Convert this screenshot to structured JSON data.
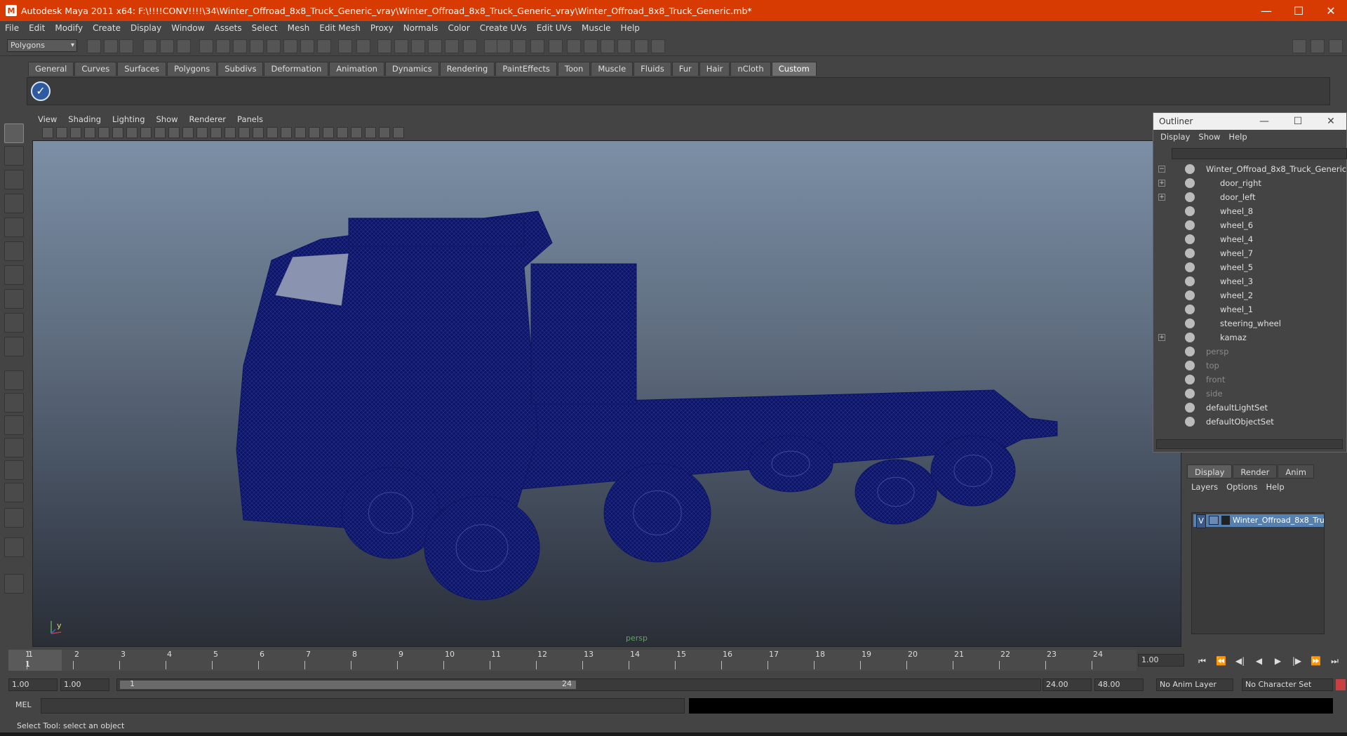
{
  "window": {
    "title": "Autodesk Maya 2011 x64: F:\\!!!!CONV!!!!\\34\\Winter_Offroad_8x8_Truck_Generic_vray\\Winter_Offroad_8x8_Truck_Generic_vray\\Winter_Offroad_8x8_Truck_Generic.mb*",
    "minimize": "—",
    "maximize": "☐",
    "close": "✕"
  },
  "menubar": [
    "File",
    "Edit",
    "Modify",
    "Create",
    "Display",
    "Window",
    "Assets",
    "Select",
    "Mesh",
    "Edit Mesh",
    "Proxy",
    "Normals",
    "Color",
    "Create UVs",
    "Edit UVs",
    "Muscle",
    "Help"
  ],
  "mode_menu": {
    "value": "Polygons"
  },
  "shelf": {
    "tabs": [
      "General",
      "Curves",
      "Surfaces",
      "Polygons",
      "Subdivs",
      "Deformation",
      "Animation",
      "Dynamics",
      "Rendering",
      "PaintEffects",
      "Toon",
      "Muscle",
      "Fluids",
      "Fur",
      "Hair",
      "nCloth",
      "Custom"
    ],
    "active_tab": "Custom",
    "button_glyph": "✓"
  },
  "viewport": {
    "menus": [
      "View",
      "Shading",
      "Lighting",
      "Show",
      "Renderer",
      "Panels"
    ],
    "camera_label": "persp",
    "axis_y": "y",
    "wire_color": "#0d1566"
  },
  "outliner": {
    "title": "Outliner",
    "menus": [
      "Display",
      "Show",
      "Help"
    ],
    "items": [
      {
        "label": "Winter_Offroad_8x8_Truck_Generic",
        "expander": "−",
        "dim": false,
        "depth": 0
      },
      {
        "label": "door_right",
        "expander": "+",
        "dim": false,
        "depth": 1
      },
      {
        "label": "door_left",
        "expander": "+",
        "dim": false,
        "depth": 1
      },
      {
        "label": "wheel_8",
        "expander": "",
        "dim": false,
        "depth": 1
      },
      {
        "label": "wheel_6",
        "expander": "",
        "dim": false,
        "depth": 1
      },
      {
        "label": "wheel_4",
        "expander": "",
        "dim": false,
        "depth": 1
      },
      {
        "label": "wheel_7",
        "expander": "",
        "dim": false,
        "depth": 1
      },
      {
        "label": "wheel_5",
        "expander": "",
        "dim": false,
        "depth": 1
      },
      {
        "label": "wheel_3",
        "expander": "",
        "dim": false,
        "depth": 1
      },
      {
        "label": "wheel_2",
        "expander": "",
        "dim": false,
        "depth": 1
      },
      {
        "label": "wheel_1",
        "expander": "",
        "dim": false,
        "depth": 1
      },
      {
        "label": "steering_wheel",
        "expander": "",
        "dim": false,
        "depth": 1
      },
      {
        "label": "kamaz",
        "expander": "+",
        "dim": false,
        "depth": 1
      },
      {
        "label": "persp",
        "expander": "",
        "dim": true,
        "depth": 0
      },
      {
        "label": "top",
        "expander": "",
        "dim": true,
        "depth": 0
      },
      {
        "label": "front",
        "expander": "",
        "dim": true,
        "depth": 0
      },
      {
        "label": "side",
        "expander": "",
        "dim": true,
        "depth": 0
      },
      {
        "label": "defaultLightSet",
        "expander": "",
        "dim": false,
        "depth": 0
      },
      {
        "label": "defaultObjectSet",
        "expander": "",
        "dim": false,
        "depth": 0
      }
    ]
  },
  "layers": {
    "tabs": [
      "Display",
      "Render",
      "Anim"
    ],
    "menus": [
      "Layers",
      "Options",
      "Help"
    ],
    "row": {
      "visible": "V",
      "name": "Winter_Offroad_8x8_Tru"
    }
  },
  "timeline": {
    "ticks": [
      "1",
      "2",
      "3",
      "4",
      "5",
      "6",
      "7",
      "8",
      "9",
      "10",
      "11",
      "12",
      "13",
      "14",
      "15",
      "16",
      "17",
      "18",
      "19",
      "20",
      "21",
      "22",
      "23",
      "24"
    ],
    "current_frame_top": "1",
    "current_frame": "1",
    "current_time_field": "1.00",
    "playback_glyphs": [
      "⏮",
      "⏪",
      "◀|",
      "◀",
      "▶",
      "|▶",
      "⏩",
      "⏭"
    ]
  },
  "range": {
    "start": "1.00",
    "inner_start": "1.00",
    "slider_start": "1",
    "slider_end": "24",
    "end": "24.00",
    "outer_end": "48.00",
    "anim_layer": "No Anim Layer",
    "character_set": "No Character Set"
  },
  "command": {
    "label": "MEL"
  },
  "help_line": "Select Tool: select an object"
}
